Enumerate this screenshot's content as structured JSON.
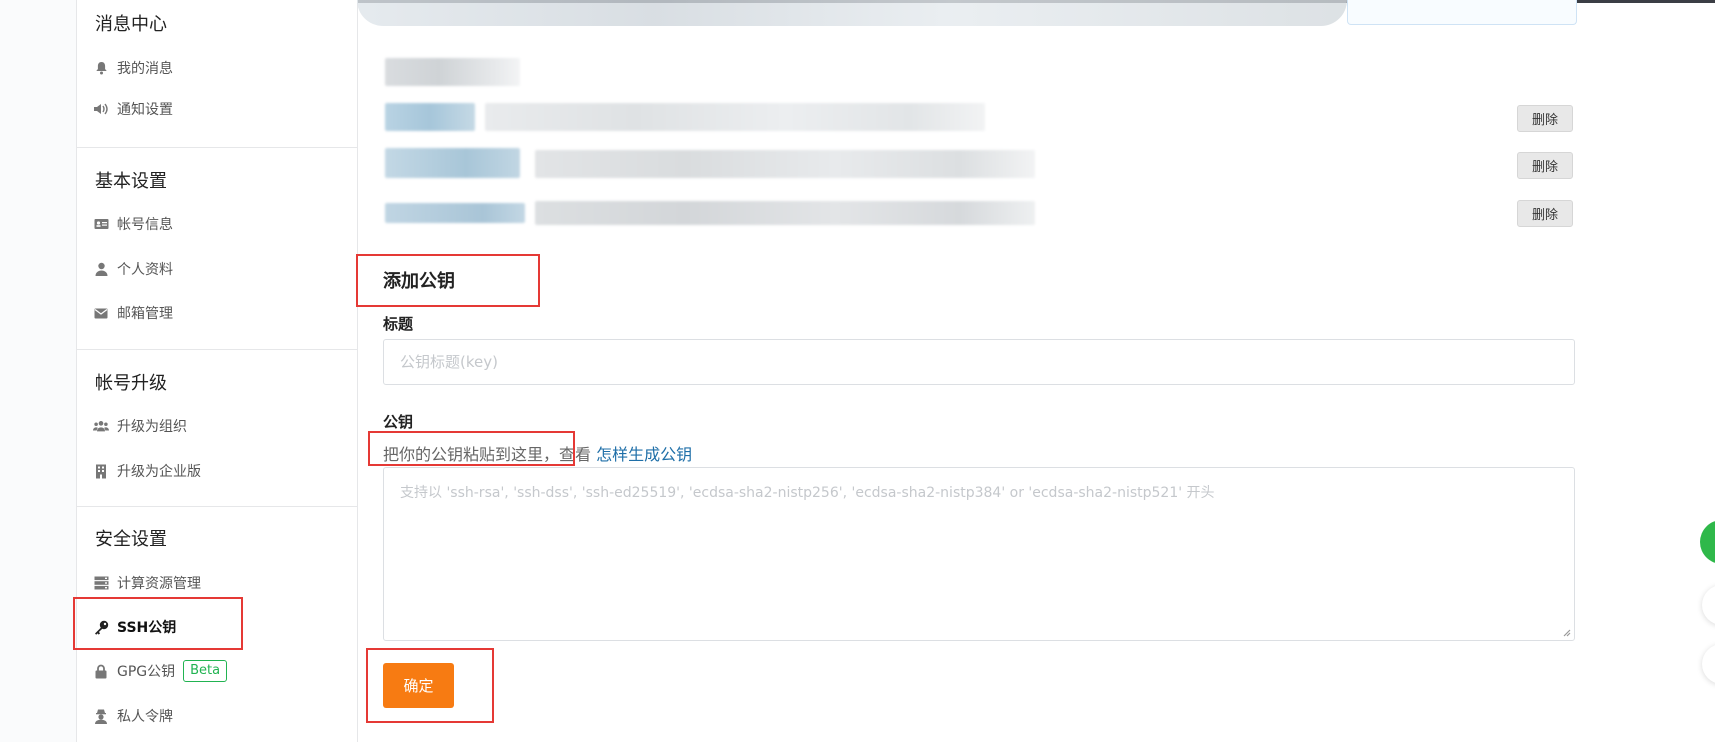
{
  "sidebar": {
    "groups": [
      {
        "title": "消息中心",
        "items": [
          {
            "label": "我的消息",
            "icon": "bell-icon"
          },
          {
            "label": "通知设置",
            "icon": "speaker-icon"
          }
        ]
      },
      {
        "title": "基本设置",
        "items": [
          {
            "label": "帐号信息",
            "icon": "id-card-icon"
          },
          {
            "label": "个人资料",
            "icon": "user-icon"
          },
          {
            "label": "邮箱管理",
            "icon": "envelope-icon"
          }
        ]
      },
      {
        "title": "帐号升级",
        "items": [
          {
            "label": "升级为组织",
            "icon": "users-icon"
          },
          {
            "label": "升级为企业版",
            "icon": "building-icon"
          }
        ]
      },
      {
        "title": "安全设置",
        "items": [
          {
            "label": "计算资源管理",
            "icon": "server-icon"
          },
          {
            "label": "SSH公钥",
            "icon": "key-icon",
            "active": true
          },
          {
            "label": "GPG公钥",
            "icon": "lock-icon",
            "badge": "Beta"
          },
          {
            "label": "私人令牌",
            "icon": "agent-icon"
          }
        ]
      }
    ]
  },
  "keys_list": {
    "delete_label": "删除",
    "rows": 3
  },
  "form": {
    "section_title": "添加公钥",
    "title_label": "标题",
    "title_placeholder": "公钥标题(key)",
    "key_label": "公钥",
    "hint_text": "把你的公钥粘贴到这里，查看",
    "hint_link": "怎样生成公钥",
    "key_placeholder": "支持以 'ssh-rsa', 'ssh-dss', 'ssh-ed25519', 'ecdsa-sha2-nistp256', 'ecdsa-sha2-nistp384' or 'ecdsa-sha2-nistp521' 开头",
    "submit_label": "确定"
  },
  "colors": {
    "accent": "#f77b12",
    "link": "#1f6fa8",
    "badge": "#21b351",
    "highlight_box": "#e53935"
  }
}
